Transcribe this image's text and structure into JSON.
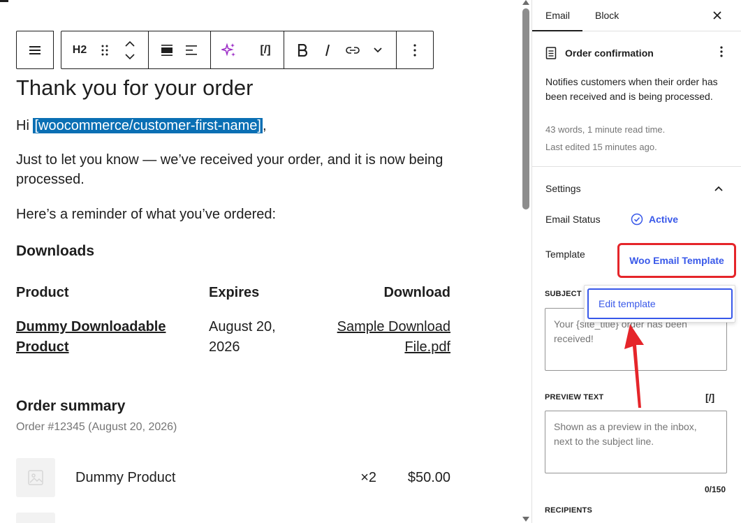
{
  "toolbar": {
    "heading_level": "H2",
    "shortcode_label": "[/]"
  },
  "document": {
    "heading": "Thank you for your order",
    "greeting_prefix": "Hi ",
    "greeting_tag": "[woocommerce/customer-first-name]",
    "greeting_suffix": ",",
    "intro": "Just to let you know — we’ve received your order, and it is now being processed.",
    "reminder": "Here’s a reminder of what you’ve ordered:",
    "downloads_heading": "Downloads",
    "downloads_table": {
      "headers": [
        "Product",
        "Expires",
        "Download"
      ],
      "rows": [
        {
          "product_line1": "Dummy Downloadable",
          "product_line2": "Product",
          "expires_line1": "August 20,",
          "expires_line2": "2026",
          "download_line1": "Sample Download",
          "download_line2": "File.pdf"
        }
      ]
    },
    "order_summary_heading": "Order summary",
    "order_meta": "Order #12345 (August 20, 2026)",
    "items": [
      {
        "name": "Dummy Product",
        "qty": "×2",
        "price": "$50.00"
      }
    ]
  },
  "sidebar": {
    "tabs": [
      "Email",
      "Block"
    ],
    "active_tab": "Email",
    "card": {
      "title": "Order confirmation",
      "description": "Notifies customers when their order has been received and is being processed.",
      "stats": "43 words, 1 minute read time.",
      "last_edited": "Last edited 15 minutes ago."
    },
    "settings": {
      "heading": "Settings",
      "status_label": "Email Status",
      "status_value": "Active",
      "template_label": "Template",
      "template_value": "Woo Email Template",
      "subject_label": "SUBJECT",
      "subject_placeholder": "Your {site_title} order has been received!",
      "preview_label": "PREVIEW TEXT",
      "preview_shortcode": "[/]",
      "preview_placeholder": "Shown as a preview in the inbox, next to the subject line.",
      "preview_count": "0/150",
      "recipients_label": "RECIPIENTS"
    },
    "popover": {
      "edit_template": "Edit template"
    }
  },
  "colors": {
    "accent": "#3858e9",
    "highlight": "#0a6fb4",
    "annotation_red": "#e5252a",
    "ai_purple": "#9b2bc6"
  }
}
